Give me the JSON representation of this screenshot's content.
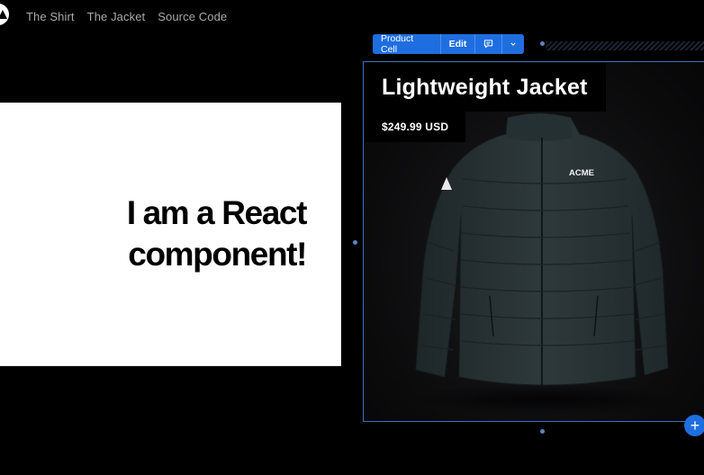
{
  "nav": {
    "logo_icon": "triangle-logo-icon",
    "links": [
      "The Shirt",
      "The Jacket",
      "Source Code"
    ]
  },
  "react_card": {
    "heading": "I am a React component!"
  },
  "toolbar": {
    "label": "Product Cell",
    "edit": "Edit",
    "comment_icon": "comment-icon",
    "more_icon": "chevron-down-icon",
    "accent_color": "#1f6ee0"
  },
  "product": {
    "title": "Lightweight Jacket",
    "price": "$249.99 USD",
    "brand_mark": "ACME",
    "image_icon": "jacket-image"
  },
  "add_button": {
    "label": "+"
  }
}
